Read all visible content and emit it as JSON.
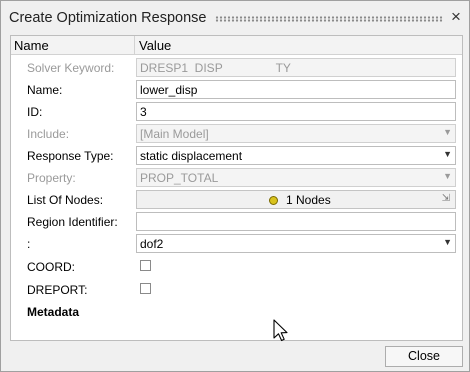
{
  "window": {
    "title": "Create Optimization Response"
  },
  "columns": {
    "name": "Name",
    "value": "Value"
  },
  "rows": [
    {
      "label": "Solver Keyword:",
      "value": "DRESP1  DISP                TY"
    },
    {
      "label": "Name:",
      "value": "lower_disp"
    },
    {
      "label": "ID:",
      "value": "3"
    },
    {
      "label": "Include:",
      "value": "[Main Model]"
    },
    {
      "label": "Response Type:",
      "value": "static displacement"
    },
    {
      "label": "Property:",
      "value": "PROP_TOTAL"
    },
    {
      "label": "List Of Nodes:",
      "value": "1 Nodes"
    },
    {
      "label": "Region Identifier:",
      "value": ""
    },
    {
      "label": ":",
      "value": "dof2"
    },
    {
      "label": "COORD:",
      "value": false
    },
    {
      "label": "DREPORT:",
      "value": false
    },
    {
      "label": "Metadata"
    }
  ],
  "footer": {
    "close_label": "Close"
  },
  "colors": {
    "node_dot": "#d8c21d",
    "background": "#f0f0f0"
  }
}
